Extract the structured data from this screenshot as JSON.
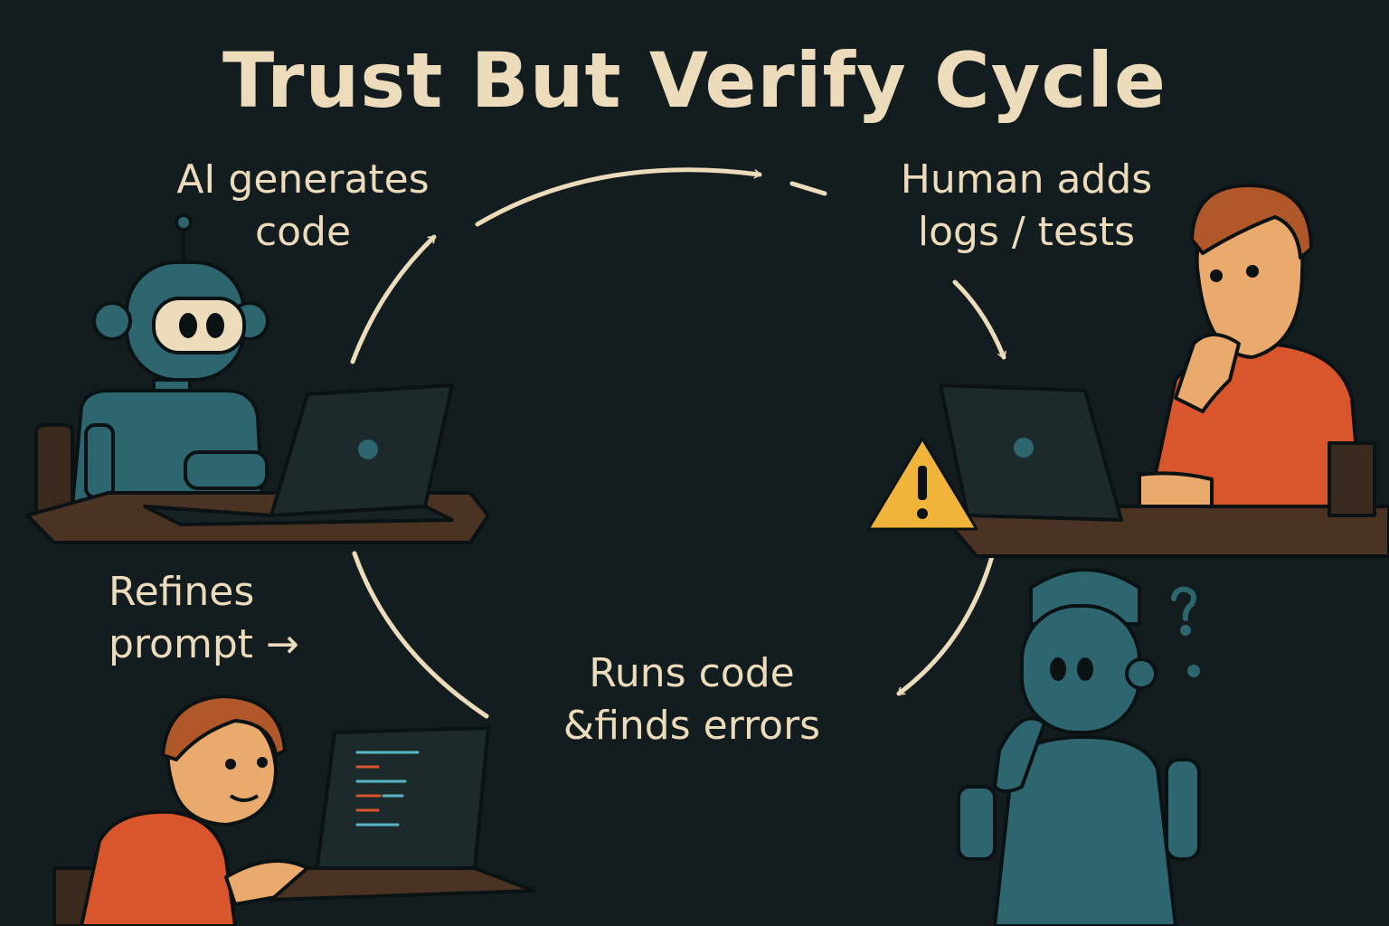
{
  "title": "Trust But Verify Cycle",
  "steps": [
    {
      "line1": "AI generates",
      "line2": "code"
    },
    {
      "line1": "Human adds",
      "line2": "logs / tests"
    },
    {
      "line1": "Runs code",
      "line2": "&finds errors"
    },
    {
      "line1": "Refines",
      "line2": "prompt →"
    }
  ],
  "icons": {
    "robot_coder": "robot-typing-laptop",
    "human_tester": "human-thinking-laptop",
    "warning": "warning-triangle",
    "confused_robot": "robot-question-marks",
    "human_coder": "human-typing-laptop"
  },
  "colors": {
    "background": "#131d1f",
    "text": "#eddcbc",
    "robot": "#2e6670",
    "shirt": "#d9552b",
    "hair": "#b0582a",
    "skin": "#eaa96d",
    "warning": "#f0b43a"
  }
}
